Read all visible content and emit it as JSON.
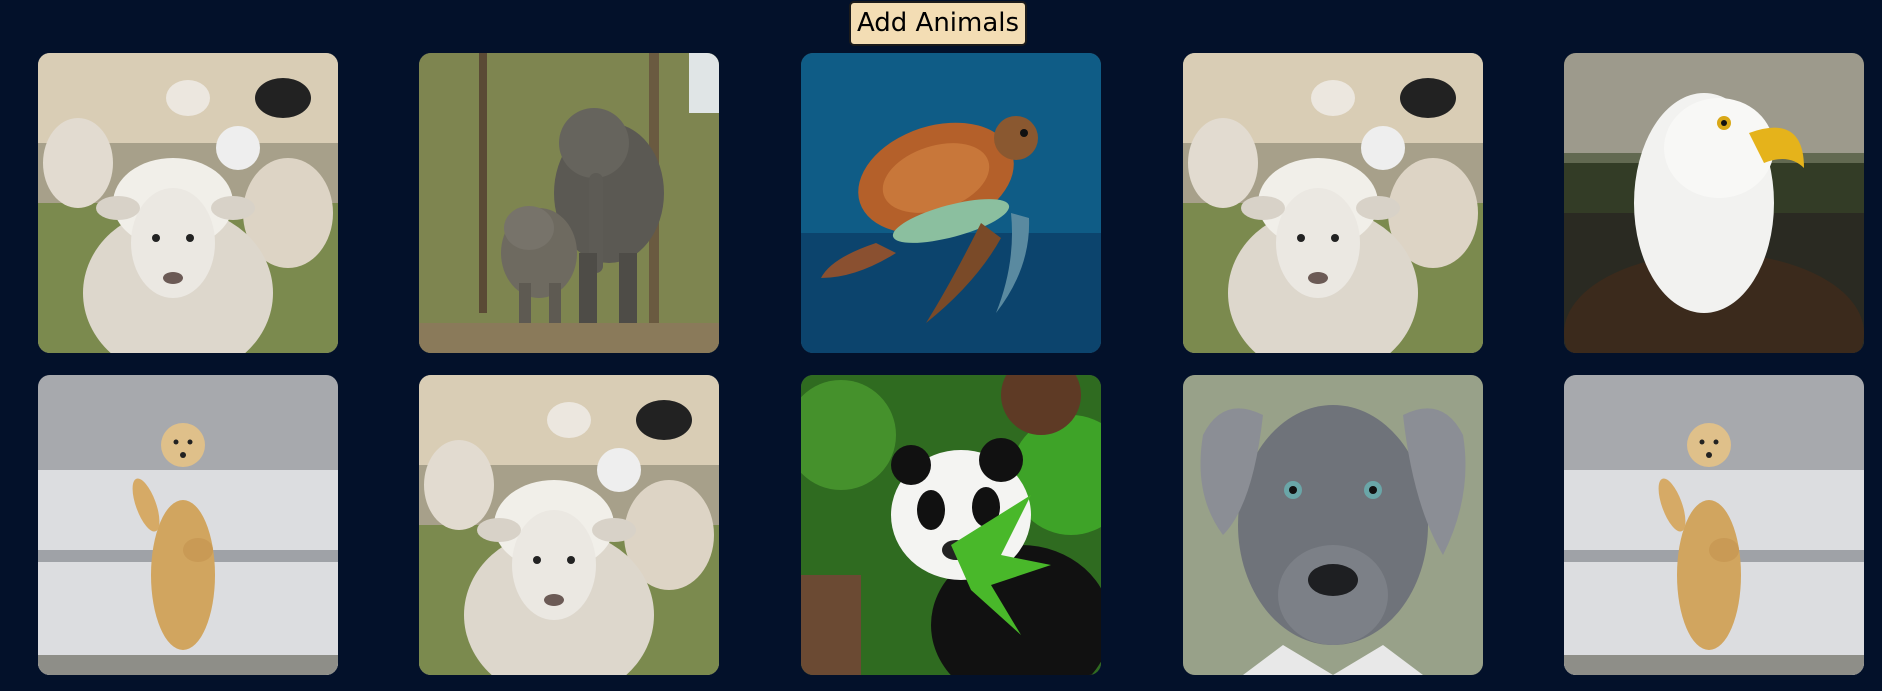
{
  "toolbar": {
    "add_label": "Add Animals"
  },
  "gallery": {
    "cards": [
      {
        "animal": "sheep-image"
      },
      {
        "animal": "elephant-image"
      },
      {
        "animal": "turtle-image"
      },
      {
        "animal": "sheep-image"
      },
      {
        "animal": "eagle-image"
      },
      {
        "animal": "polar-bear-image"
      },
      {
        "animal": "sheep-image"
      },
      {
        "animal": "panda-image"
      },
      {
        "animal": "dog-image"
      },
      {
        "animal": "polar-bear-image"
      }
    ]
  },
  "colors": {
    "background": "#03112a",
    "button_bg": "#f3ddb4"
  }
}
